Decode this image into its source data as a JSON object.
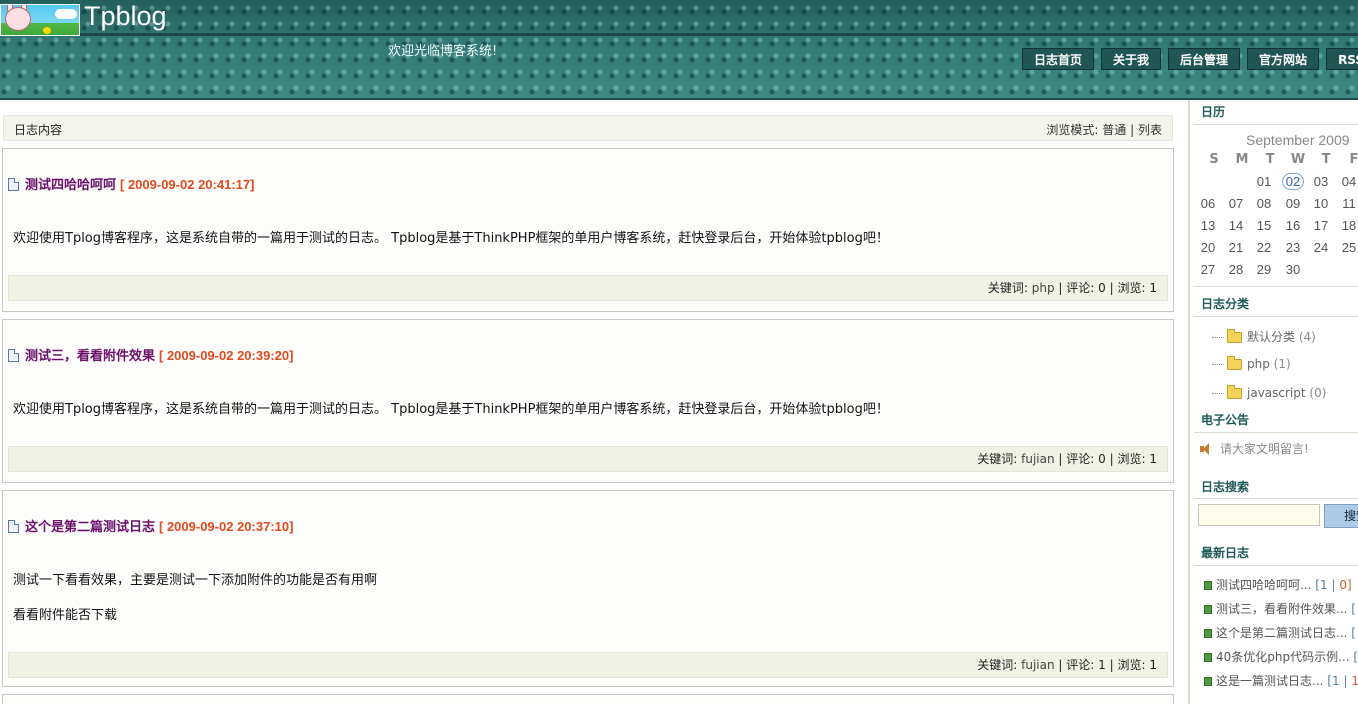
{
  "header": {
    "site_title": "Tpblog",
    "welcome": "欢迎光临博客系统!",
    "nav": [
      "日志首页",
      "关于我",
      "后台管理",
      "官方网站",
      "RSS"
    ]
  },
  "content_bar": {
    "label": "日志内容",
    "view_mode_label": "浏览模式:",
    "mode_normal": "普通",
    "mode_list": "列表"
  },
  "posts": [
    {
      "title": "测试四哈哈呵呵",
      "date": "[ 2009-09-02 20:41:17]",
      "body": [
        "欢迎使用Tplog博客程序，这是系统自带的一篇用于测试的日志。 Tpblog是基于ThinkPHP框架的单用户博客系统，赶快登录后台，开始体验tpblog吧！"
      ],
      "keywords_label": "关键词:",
      "keywords": "php",
      "comments": "评论: 0",
      "views": "浏览: 1"
    },
    {
      "title": "测试三，看看附件效果",
      "date": "[ 2009-09-02 20:39:20]",
      "body": [
        "欢迎使用Tplog博客程序，这是系统自带的一篇用于测试的日志。 Tpblog是基于ThinkPHP框架的单用户博客系统，赶快登录后台，开始体验tpblog吧！"
      ],
      "keywords_label": "关键词:",
      "keywords": "fujian",
      "comments": "评论: 0",
      "views": "浏览: 1"
    },
    {
      "title": "这个是第二篇测试日志",
      "date": "[ 2009-09-02 20:37:10]",
      "body": [
        "测试一下看看效果，主要是测试一下添加附件的功能是否有用啊",
        "看看附件能否下载"
      ],
      "keywords_label": "关键词:",
      "keywords": "fujian",
      "comments": "评论: 1",
      "views": "浏览: 1"
    }
  ],
  "sidebar": {
    "calendar_title": "日历",
    "calendar_month": "September 2009",
    "weekdays": [
      "S",
      "M",
      "T",
      "W",
      "T",
      "F"
    ],
    "weeks": [
      [
        "",
        "",
        "01",
        "02",
        "03",
        "04"
      ],
      [
        "06",
        "07",
        "08",
        "09",
        "10",
        "11"
      ],
      [
        "13",
        "14",
        "15",
        "16",
        "17",
        "18"
      ],
      [
        "20",
        "21",
        "22",
        "23",
        "24",
        "25"
      ],
      [
        "27",
        "28",
        "29",
        "30",
        "",
        ""
      ]
    ],
    "today": "02",
    "categories_title": "日志分类",
    "categories": [
      {
        "name": "默认分类",
        "count": "(4)"
      },
      {
        "name": "php",
        "count": "(1)"
      },
      {
        "name": "javascript",
        "count": "(0)"
      }
    ],
    "notice_title": "电子公告",
    "notice_text": "请大家文明留言!",
    "search_title": "日志搜索",
    "search_button": "搜索",
    "latest_title": "最新日志",
    "latest": [
      {
        "title": "测试四哈哈呵呵...",
        "c1": "[1",
        "c2": "0]"
      },
      {
        "title": "测试三，看看附件效果...",
        "c1": "[",
        "c2": ""
      },
      {
        "title": "这个是第二篇测试日志...",
        "c1": "[",
        "c2": ""
      },
      {
        "title": "40条优化php代码示例...",
        "c1": "[",
        "c2": ""
      },
      {
        "title": "这是一篇测试日志...",
        "c1": "[1",
        "c2": "1"
      }
    ]
  },
  "colors": {
    "header_bg": "#2e6f6b",
    "post_title": "#6b0f6b",
    "post_date": "#e04a1f",
    "sidebar_title": "#1e5a57"
  }
}
